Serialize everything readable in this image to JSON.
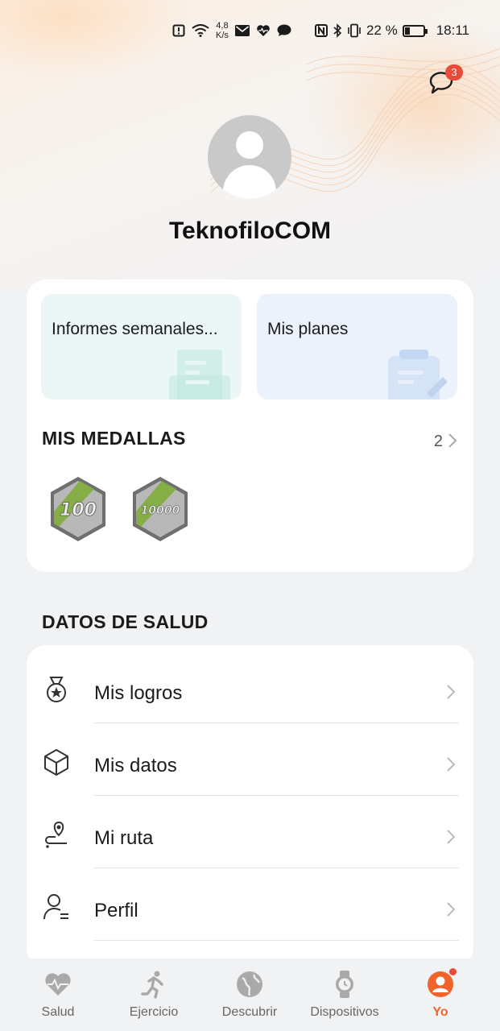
{
  "status_bar": {
    "net_speed_value": "4,8",
    "net_speed_unit": "K/s",
    "battery": "22 %",
    "time": "18:11"
  },
  "header": {
    "messages_badge": "3",
    "username": "TeknofiloCOM"
  },
  "tiles": {
    "weekly_reports": "Informes semanales...",
    "my_plans": "Mis planes"
  },
  "medals": {
    "title": "MIS MEDALLAS",
    "count": "2",
    "items": [
      {
        "label": "100"
      },
      {
        "label": "10000"
      }
    ]
  },
  "health": {
    "title": "DATOS DE SALUD",
    "items": [
      {
        "label": "Mis logros",
        "icon": "medal-icon"
      },
      {
        "label": "Mis datos",
        "icon": "cube-icon"
      },
      {
        "label": "Mi ruta",
        "icon": "route-icon"
      },
      {
        "label": "Perfil",
        "icon": "profile-icon"
      }
    ]
  },
  "bottom_nav": {
    "items": [
      {
        "label": "Salud",
        "icon": "heart-pulse-icon"
      },
      {
        "label": "Ejercicio",
        "icon": "running-icon"
      },
      {
        "label": "Descubrir",
        "icon": "globe-icon"
      },
      {
        "label": "Dispositivos",
        "icon": "watch-icon"
      },
      {
        "label": "Yo",
        "icon": "user-icon"
      }
    ],
    "active": "Yo"
  },
  "colors": {
    "accent": "#f0632a",
    "badge": "#e84a3c"
  }
}
